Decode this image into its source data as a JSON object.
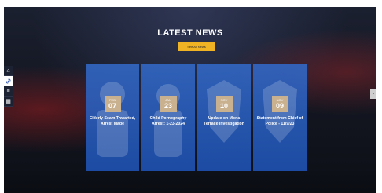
{
  "section": {
    "title": "LATEST NEWS",
    "see_all_label": "See All News"
  },
  "sidebar": {
    "items": [
      {
        "icon": "home-icon",
        "glyph": "⌂"
      },
      {
        "icon": "link-icon",
        "glyph": "🔗"
      },
      {
        "icon": "document-icon",
        "glyph": "≡"
      },
      {
        "icon": "calendar-icon",
        "glyph": "▦"
      }
    ]
  },
  "news": [
    {
      "month": "FEB",
      "day": "07",
      "headline": "Elderly Scam Thwarted, Arrest Made"
    },
    {
      "month": "JAN",
      "day": "23",
      "headline": "Child Pornography Arrest: 1-23-2024"
    },
    {
      "month": "NOV",
      "day": "10",
      "headline": "Update on Mona Terrace investigation"
    },
    {
      "month": "NOV",
      "day": "09",
      "headline": "Statement from Chief of Police - 11/9/23"
    }
  ],
  "colors": {
    "accent": "#f0b323",
    "card_blue": "#2f66c4",
    "date_tile": "#c9b08f"
  }
}
